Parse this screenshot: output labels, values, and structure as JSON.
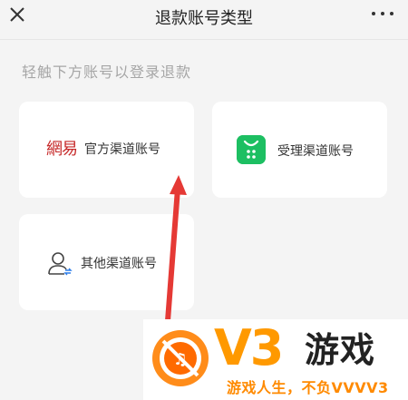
{
  "header": {
    "title": "退款账号类型"
  },
  "hint": "轻触下方账号以登录退款",
  "cards": {
    "official": {
      "logo_text": "網易",
      "label": "官方渠道账号"
    },
    "agent": {
      "label": "受理渠道账号"
    },
    "other": {
      "label": "其他渠道账号"
    }
  },
  "watermark": {
    "brand": "V3",
    "brand_suffix": "游戏",
    "slogan": "游戏人生，不负VVVV3"
  },
  "colors": {
    "accent_green": "#1dbf62",
    "netease_red": "#c62828",
    "arrow_red": "#e53935",
    "watermark_orange": "#ff9900"
  }
}
